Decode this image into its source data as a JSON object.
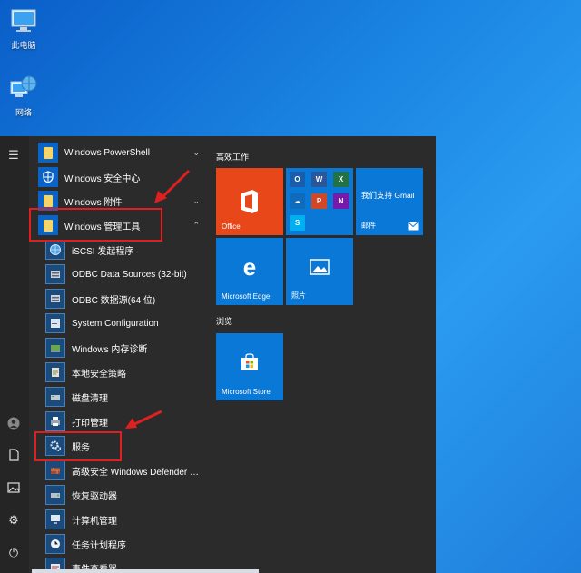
{
  "desktop": {
    "icons": [
      {
        "label": "此电脑"
      },
      {
        "label": "网络"
      }
    ]
  },
  "start_menu": {
    "rail": {
      "menu_glyph": "☰",
      "user_glyph": "👤",
      "doc_glyph": "🗋",
      "pic_glyph": "🖼",
      "settings_glyph": "⚙",
      "power_glyph": "⏻"
    },
    "apps": [
      {
        "label": "Windows PowerShell",
        "chevron": "⌄"
      },
      {
        "label": "Windows 安全中心"
      },
      {
        "label": "Windows 附件",
        "chevron": "⌄"
      },
      {
        "label": "Windows 管理工具",
        "chevron": "⌃"
      },
      {
        "label": "iSCSI 发起程序"
      },
      {
        "label": "ODBC Data Sources (32-bit)"
      },
      {
        "label": "ODBC 数据源(64 位)"
      },
      {
        "label": "System Configuration"
      },
      {
        "label": "Windows 内存诊断"
      },
      {
        "label": "本地安全策略"
      },
      {
        "label": "磁盘清理"
      },
      {
        "label": "打印管理"
      },
      {
        "label": "服务"
      },
      {
        "label": "高级安全 Windows Defender 防..."
      },
      {
        "label": "恢复驱动器"
      },
      {
        "label": "计算机管理"
      },
      {
        "label": "任务计划程序"
      },
      {
        "label": "事件查看器"
      }
    ],
    "tiles": {
      "group1": "高效工作",
      "group2": "浏览",
      "office": "Office",
      "mail_title": "我们支持 Gmail",
      "mail": "邮件",
      "edge": "Microsoft Edge",
      "photos": "照片",
      "store": "Microsoft Store"
    }
  },
  "colors": {
    "highlight": "#e02020",
    "office_tile": "#e8471a",
    "tile_blue": "#0a78d7"
  }
}
